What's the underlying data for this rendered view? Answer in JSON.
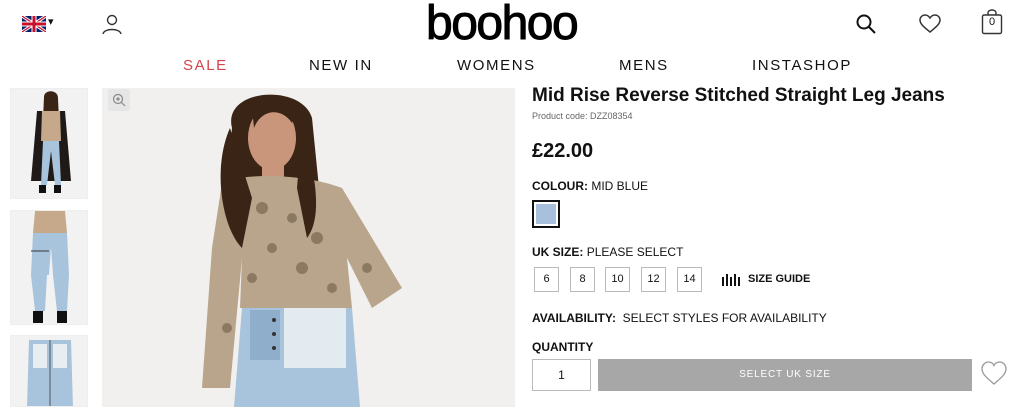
{
  "header": {
    "flag_caret": "▾",
    "logo": "boohoo",
    "bag_count": "0"
  },
  "nav": {
    "items": [
      "SALE",
      "NEW IN",
      "WOMENS",
      "MENS",
      "INSTASHOP"
    ],
    "sale_color": "#d0454c"
  },
  "product": {
    "title": "Mid Rise Reverse Stitched Straight Leg Jeans",
    "code": "Product code: DZZ08354",
    "price": "£22.00",
    "colour_label": "COLOUR:",
    "colour_value": "MID BLUE",
    "swatch_color": "#a8c0db",
    "size_label": "UK SIZE:",
    "size_value": "PLEASE SELECT",
    "sizes": [
      "6",
      "8",
      "10",
      "12",
      "14"
    ],
    "size_guide": "SIZE GUIDE",
    "availability_label": "AVAILABILITY:",
    "availability_value": "SELECT STYLES FOR AVAILABILITY",
    "quantity_label": "QUANTITY",
    "quantity_value": "1",
    "add_button": "SELECT UK SIZE"
  },
  "icons": {
    "flag": "uk-flag-icon",
    "account": "account-icon",
    "search": "search-icon",
    "wishlist": "heart-icon",
    "bag": "bag-icon",
    "zoom": "zoom-icon",
    "size_guide": "ruler-icon"
  }
}
